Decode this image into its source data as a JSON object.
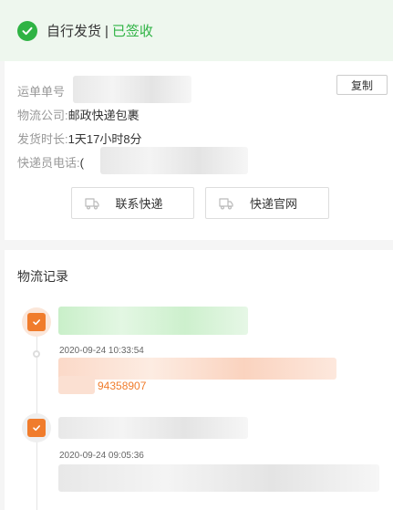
{
  "status": {
    "method": "自行发货",
    "separator": "|",
    "state": "已签收",
    "accent": "#2fb344"
  },
  "shipment": {
    "tracking_label": "运单单号",
    "copy_label": "复制",
    "company_label": "物流公司:",
    "company_value": "邮政快递包裹",
    "duration_label": "发货时长:",
    "duration_value": "1天17小时8分",
    "courier_phone_label": "快递员电话:",
    "courier_phone_prefix": "(",
    "contact_button": "联系快递",
    "website_button": "快递官网"
  },
  "logistics": {
    "title": "物流记录",
    "accent": "#f07c2c",
    "records": [
      {
        "time": "2020-09-24 10:33:54",
        "detail_tail": "94358907"
      },
      {
        "time": "2020-09-24 09:05:36"
      }
    ]
  },
  "icons": {
    "status": "check-circle-icon",
    "copy": "copy-icon",
    "truck": "truck-icon",
    "record": "clipboard-check-icon"
  }
}
